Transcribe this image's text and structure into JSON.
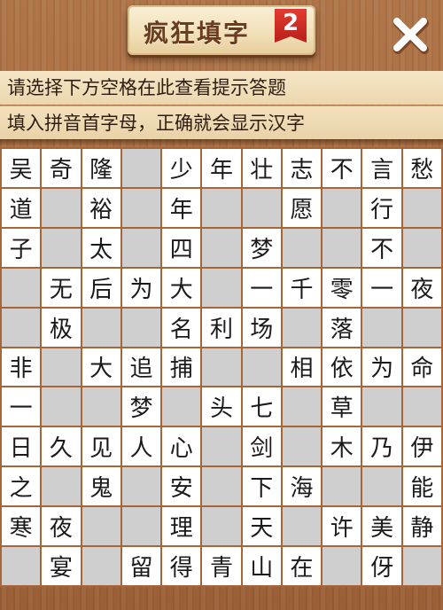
{
  "header": {
    "title": "疯狂填字",
    "level_badge": "2",
    "close_label": "✕"
  },
  "hints": [
    "请选择下方空格在此查看提示答题",
    "填入拼音首字母，正确就会显示汉字"
  ],
  "grid": [
    [
      "吴",
      "奇",
      "隆",
      "",
      "少",
      "年",
      "壮",
      "志",
      "不",
      "言",
      "愁"
    ],
    [
      "道",
      "",
      "裕",
      "",
      "年",
      "",
      "",
      "愿",
      "",
      "行",
      ""
    ],
    [
      "子",
      "",
      "太",
      "",
      "四",
      "",
      "梦",
      "",
      "",
      "不",
      ""
    ],
    [
      "",
      "无",
      "后",
      "为",
      "大",
      "",
      "一",
      "千",
      "零",
      "一",
      "夜"
    ],
    [
      "",
      "极",
      "",
      "",
      "名",
      "利",
      "场",
      "",
      "落",
      "",
      ""
    ],
    [
      "非",
      "",
      "大",
      "追",
      "捕",
      "",
      "",
      "相",
      "依",
      "为",
      "命"
    ],
    [
      "一",
      "",
      "",
      "梦",
      "",
      "头",
      "七",
      "",
      "草",
      "",
      ""
    ],
    [
      "日",
      "久",
      "见",
      "人",
      "心",
      "",
      "剑",
      "",
      "木",
      "乃",
      "伊"
    ],
    [
      "之",
      "",
      "鬼",
      "",
      "安",
      "",
      "下",
      "海",
      "",
      "",
      "能"
    ],
    [
      "寒",
      "夜",
      "",
      "",
      "理",
      "",
      "天",
      "",
      "许",
      "美",
      "静"
    ],
    [
      "",
      "宴",
      "",
      "留",
      "得",
      "青",
      "山",
      "在",
      "",
      "伢",
      ""
    ]
  ]
}
